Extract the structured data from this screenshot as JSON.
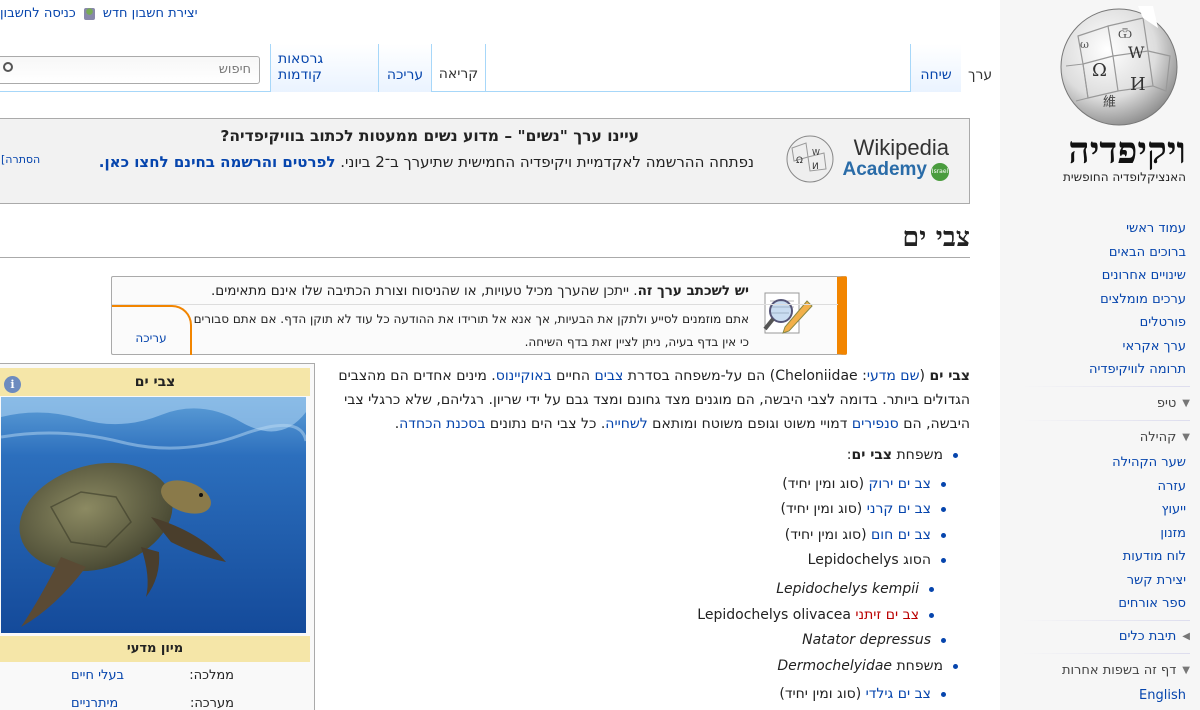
{
  "personal": {
    "create_account": "יצירת חשבון חדש",
    "login": "כניסה לחשבון"
  },
  "logo": {
    "wordmark": "ויקיפדיה",
    "tagline": "האנציקלופדיה החופשית"
  },
  "nav": [
    "עמוד ראשי",
    "ברוכים הבאים",
    "שינויים אחרונים",
    "ערכים מומלצים",
    "פורטלים",
    "ערך אקראי",
    "תרומה לוויקיפדיה"
  ],
  "sections": {
    "tips": "טיפ",
    "community": "קהילה",
    "toolbox": "תיבת כלים",
    "languages": "דף זה בשפות אחרות"
  },
  "community": [
    "שער הקהילה",
    "עזרה",
    "ייעוץ",
    "מזנון",
    "לוח מודעות",
    "יצירת קשר",
    "ספר אורחים"
  ],
  "languages": [
    "English"
  ],
  "tabs": {
    "article": "ערך",
    "talk": "שיחה",
    "read": "קריאה",
    "edit": "עריכה",
    "history": "גרסאות קודמות"
  },
  "search": {
    "placeholder": "חיפוש"
  },
  "banner": {
    "logo_line1": "Wikipedia",
    "logo_line2": "Academy",
    "logo_badge": "Israel",
    "title": "עיינו ערך \"נשים\" – מדוע נשים ממעטות לכתוב בוויקיפדיה?",
    "body": "נפתחה ההרשמה לאקדמיית ויקיפדיה החמישית שתיערך ב־2 ביוני.",
    "link": "לפרטים והרשמה בחינם לחצו כאן.",
    "hide": "[הסתרה"
  },
  "page_title": "צבי ים",
  "maintenance": {
    "lead_bold": "יש לשכתב ערך זה",
    "lead_rest": ". ייתכן שהערך מכיל טעויות, או שהניסוח וצורת הכתיבה שלו אינם מתאימים.",
    "body": "אתם מוזמנים לסייע ולתקן את הבעיות, אך אנא אל תורידו את ההודעה כל עוד לא תוקן הדף. אם אתם סבורים כי אין בדף בעיה, ניתן לציין זאת בדף השיחה.",
    "edit": "עריכה"
  },
  "infobox": {
    "title": "צבי ים",
    "info_glyph": "i",
    "taxonomy": "מיון מדעי",
    "rows": [
      {
        "label": "ממלכה:",
        "value": "בעלי חיים"
      },
      {
        "label": "מערכה:",
        "value": "מיתרניים"
      }
    ]
  },
  "lead": {
    "p1_bold": "צבי ים",
    "p1_a": " (",
    "p1_link_sci": "שם מדעי",
    "p1_b": ": Cheloniidae) הם על-משפחה בסדרת ",
    "p1_link_turtles": "צבים",
    "p1_c": " החיים ",
    "p1_link_ocean": "באוקיינוס",
    "p1_d": ". מינים אחדים הם מהצבים הגדולים ביותר. בדומה לצבי היבשה, הם מוגנים מצד גחונם ומצד גבם על ידי שריון. רגליהם, שלא כרגלי צבי היבשה, הם ",
    "p1_link_fins": "סנפירים",
    "p1_e": " דמויי משוט וגופם משוטח ומותאם ",
    "p1_link_swim": "לשחייה",
    "p1_f": ". כל צבי הים נתונים ",
    "p1_link_danger": "בסכנת הכחדה",
    "p1_g": "."
  },
  "list": {
    "family1_prefix": "משפחת ",
    "family1_name": "צבי ים",
    "species_suffix": " (סוג ומין יחיד)",
    "green": "צב ים ירוק",
    "hawksbill": "צב ים קרני",
    "loggerhead": "צב ים חום",
    "genus_prefix": "הסוג ",
    "genus_name": "Lepidochelys",
    "kempii": "Lepidochelys kempii",
    "olive_he": "צב ים זיתני",
    "olive_la": "Lepidochelys olivacea",
    "natator": "Natator depressus",
    "family2_prefix": "משפחת ",
    "family2_name": "Dermochelyidae",
    "leatherback": "צב ים גילדי"
  }
}
